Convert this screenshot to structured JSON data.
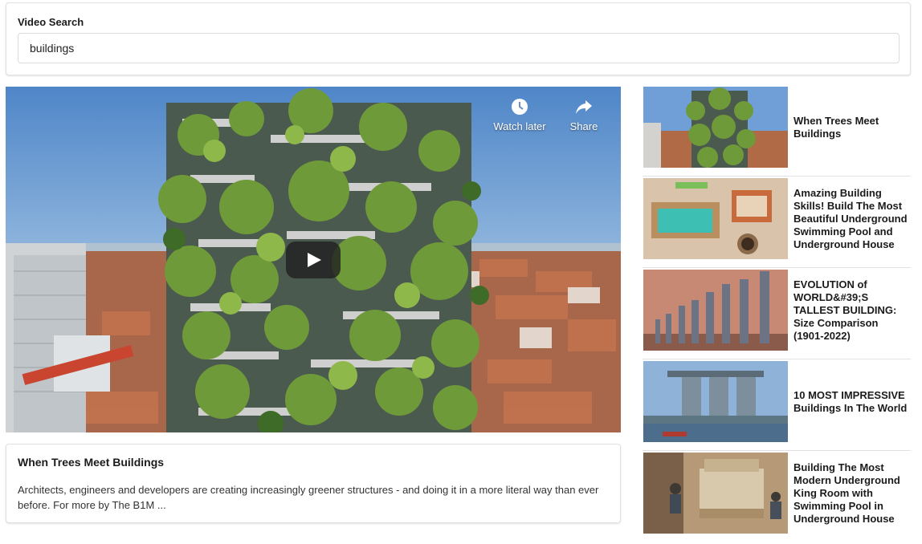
{
  "search": {
    "label": "Video Search",
    "value": "buildings"
  },
  "player": {
    "watch_later_label": "Watch later",
    "share_label": "Share",
    "icons": {
      "watch_later": "clock-icon",
      "share": "share-arrow-icon",
      "play": "play-icon"
    }
  },
  "selected_video": {
    "title": "When Trees Meet Buildings",
    "description": "Architects, engineers and developers are creating increasingly greener structures - and doing it in a more literal way than ever before. For more by The B1M ..."
  },
  "video_list": [
    {
      "title": "When Trees Meet Buildings"
    },
    {
      "title": "Amazing Building Skills! Build The Most Beautiful Underground Swimming Pool and Underground House"
    },
    {
      "title": "EVOLUTION of WORLD&#39;S TALLEST BUILDING: Size Comparison (1901-2022)"
    },
    {
      "title": "10 MOST IMPRESSIVE Buildings In The World"
    },
    {
      "title": "Building The Most Modern Underground King Room with Swimming Pool in Underground House"
    }
  ]
}
